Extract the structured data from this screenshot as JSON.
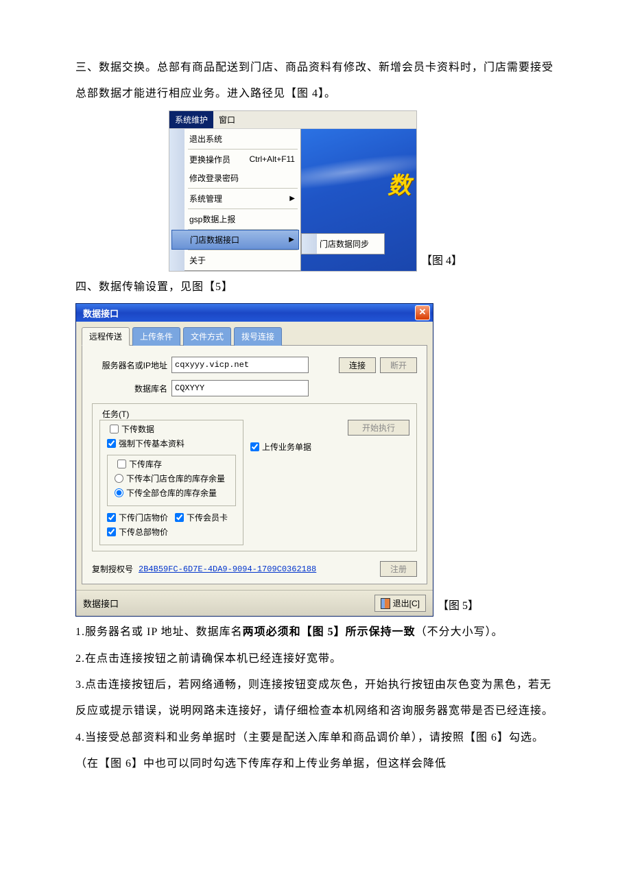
{
  "doc": {
    "para_s3": "三、数据交换。总部有商品配送到门店、商品资料有修改、新增会员卡资料时，门店需要接受总部数据才能进行相应业务。进入路径见【图 4】。",
    "fig4_caption": "【图 4】",
    "para_s4": "四、数据传输设置，见图【5】",
    "fig5_caption": "【图 5】",
    "notes": {
      "n1_a": "1.服务器名或 IP 地址、数据库名",
      "n1_b": "两项必须和【图 5】所示保持一致",
      "n1_c": "（不分大小写）。",
      "n2": "2.在点击连接按钮之前请确保本机已经连接好宽带。",
      "n3": "3.点击连接按钮后，若网络通畅，则连接按钮变成灰色，开始执行按钮由灰色变为黑色，若无反应或提示错误，说明网路未连接好，请仔细检查本机网络和咨询服务器宽带是否已经连接。",
      "n4": "4.当接受总部资料和业务单据时（主要是配送入库单和商品调价单），请按照【图 6】勾选。（在【图 6】中也可以同时勾选下传库存和上传业务单据，但这样会降低"
    }
  },
  "fig4": {
    "menubar": {
      "sysmaint": "系统维护",
      "window": "窗口"
    },
    "items": {
      "exit": "退出系统",
      "switch_op": "更换操作员",
      "switch_op_shortcut": "Ctrl+Alt+F11",
      "chpwd": "修改登录密码",
      "sysmgmt": "系统管理",
      "gsp": "gsp数据上报",
      "storeif": "门店数据接口",
      "about": "关于"
    },
    "submenu": {
      "sync": "门店数据同步"
    },
    "glyph": "数"
  },
  "fig5": {
    "title": "数据接口",
    "tabs": {
      "remote": "远程传送",
      "cond": "上传条件",
      "file": "文件方式",
      "dial": "拨号连接"
    },
    "labels": {
      "server": "服务器名或IP地址",
      "dbname": "数据库名",
      "connect": "连接",
      "disconnect": "断开",
      "tasks": "任务(T)",
      "download_data": "下传数据",
      "force_basic": "强制下传基本资料",
      "download_stock": "下传库存",
      "stock_this": "下传本门店仓库的库存余量",
      "stock_all": "下传全部仓库的库存余量",
      "store_price": "下传门店物价",
      "member": "下传会员卡",
      "hq_price": "下传总部物价",
      "upload_biz": "上传业务单据",
      "start": "开始执行",
      "auth_label": "复制授权号",
      "register": "注册",
      "status": "数据接口",
      "exit": "退出[C]"
    },
    "values": {
      "server": "cqxyyy.vicp.net",
      "dbname": "CQXYYY",
      "auth_code": "2B4B59FC-6D7E-4DA9-9094-1709C0362188"
    }
  }
}
